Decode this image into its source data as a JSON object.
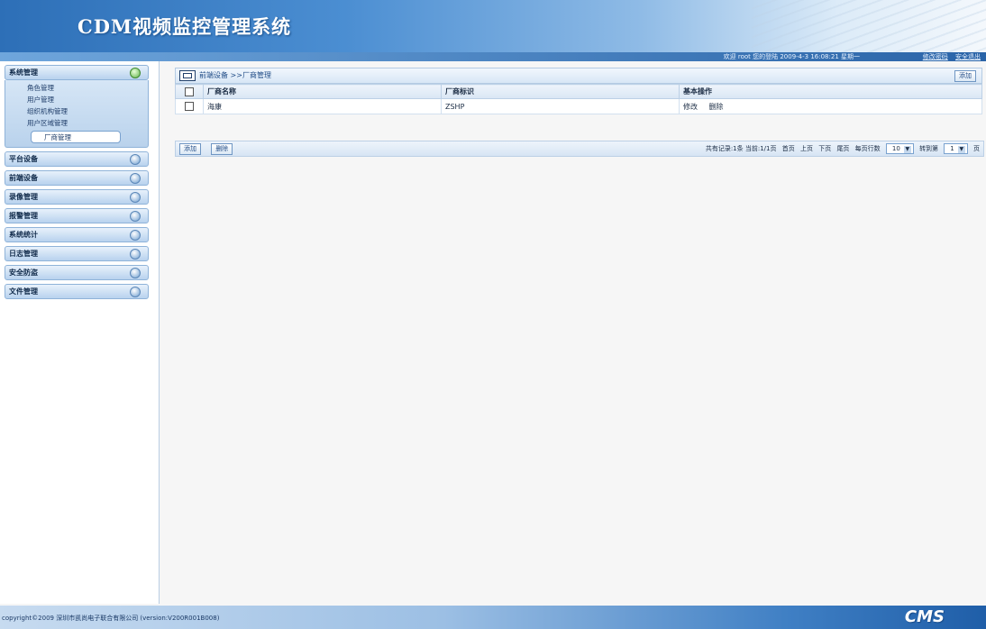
{
  "header": {
    "title": "CDM视频监控管理系统",
    "status_info": "欢迎 root 您的登陆 2009-4-3 16:08:21 星期一",
    "links": [
      "修改密码",
      "安全退出"
    ]
  },
  "sidebar": {
    "open_group": {
      "label": "系统管理",
      "items": [
        "角色管理",
        "用户管理",
        "组织机构管理",
        "用户区域管理",
        "厂商管理"
      ],
      "active_index": 4
    },
    "groups": [
      "平台设备",
      "前端设备",
      "录像管理",
      "报警管理",
      "系统统计",
      "日志管理",
      "安全防盗",
      "文件管理"
    ]
  },
  "main": {
    "breadcrumb": "前端设备 >>厂商管理",
    "add_button": "添加",
    "table": {
      "headers": [
        "厂商名称",
        "厂商标识",
        "基本操作"
      ],
      "rows": [
        {
          "name": "海康",
          "code": "ZSHP",
          "ops": [
            "修改",
            "删除"
          ]
        }
      ]
    },
    "page_buttons": [
      "添加",
      "删除"
    ],
    "pagination": {
      "summary": "共有记录:1条 当前:1/1页",
      "nav": [
        "首页",
        "上页",
        "下页",
        "尾页"
      ],
      "per_page_label": "每页行数",
      "per_page_value": "10",
      "jump_label": "转到第",
      "jump_value": "1",
      "page_suffix": "页"
    }
  },
  "footer": {
    "copyright": "copyright©2009 深圳市凯尚电子联合有限公司 (version:V200R001B008)",
    "brand": "CMS"
  }
}
